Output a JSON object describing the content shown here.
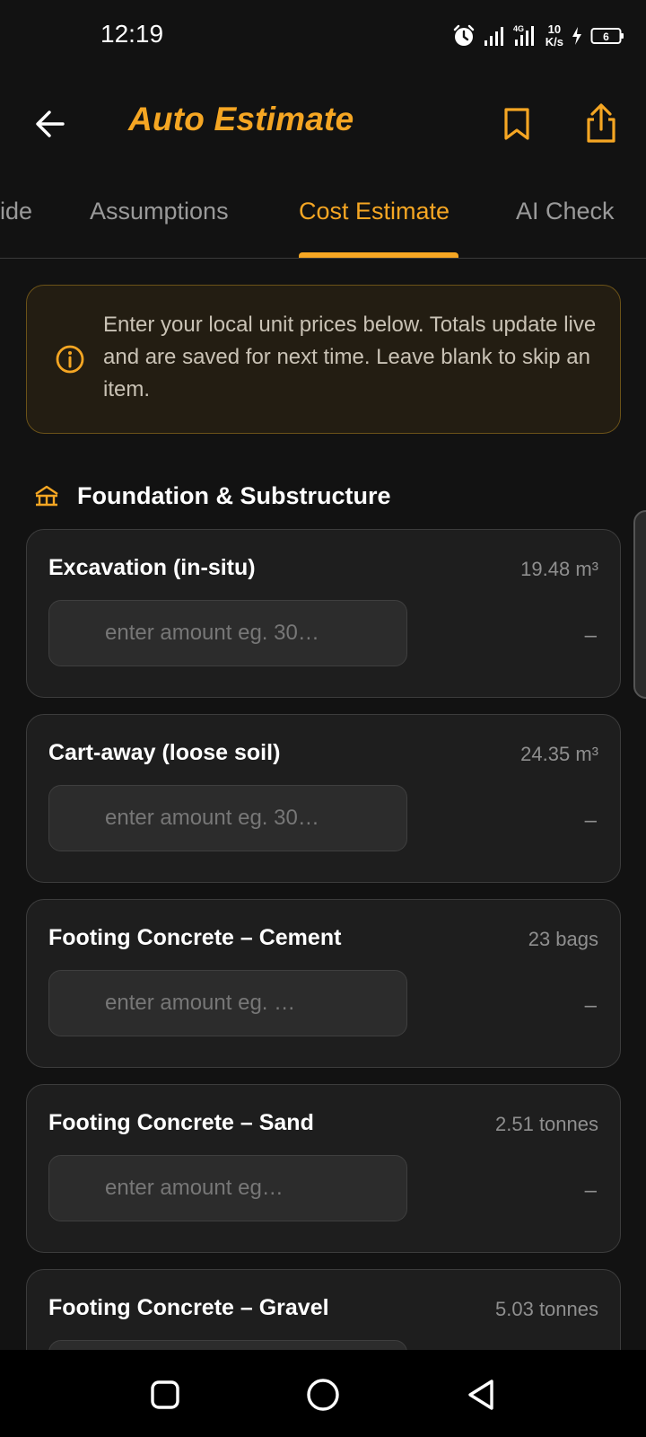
{
  "status_bar": {
    "time": "12:19",
    "network": "4G",
    "speed_value": "10",
    "speed_unit": "K/s",
    "battery": "6"
  },
  "app_bar": {
    "title": "Auto Estimate",
    "back_icon": "arrow-left-icon",
    "bookmark_icon": "bookmark-icon",
    "share_icon": "share-icon"
  },
  "tabs": [
    {
      "label": "ide"
    },
    {
      "label": "Assumptions"
    },
    {
      "label": "Cost Estimate",
      "active": true
    },
    {
      "label": "AI Check"
    }
  ],
  "info_banner": {
    "icon": "info-icon",
    "text": "Enter your local unit prices below. Totals update live and are saved for next time. Leave blank to skip an item."
  },
  "section": {
    "icon": "foundation-icon",
    "title": "Foundation & Substructure"
  },
  "items": [
    {
      "title": "Excavation (in-situ)",
      "quantity": "19.48 m³",
      "placeholder": "enter amount eg. 30…",
      "total": "–"
    },
    {
      "title": "Cart-away (loose soil)",
      "quantity": "24.35 m³",
      "placeholder": "enter amount eg. 30…",
      "total": "–"
    },
    {
      "title": "Footing Concrete – Cement",
      "quantity": "23 bags",
      "placeholder": "enter amount eg. …",
      "total": "–"
    },
    {
      "title": "Footing Concrete – Sand",
      "quantity": "2.51 tonnes",
      "placeholder": "enter amount eg…",
      "total": "–"
    },
    {
      "title": "Footing Concrete – Gravel",
      "quantity": "5.03 tonnes",
      "placeholder": "",
      "total": ""
    }
  ],
  "colors": {
    "accent": "#F5A623",
    "background": "#121212",
    "card": "#1e1e1e"
  }
}
